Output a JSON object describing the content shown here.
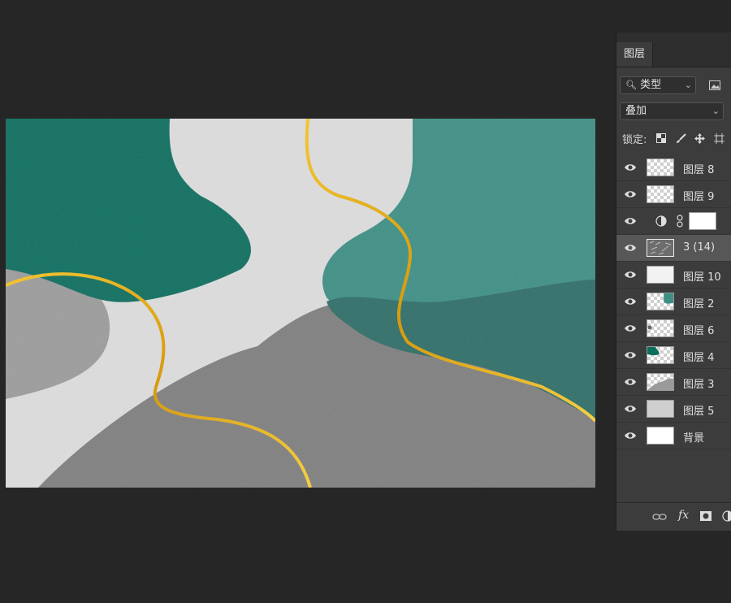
{
  "canvas": {
    "description_icon": "artwork-canvas"
  },
  "layers_panel": {
    "tab_label": "图层",
    "filter": {
      "icon": "search-icon",
      "selected": "类型"
    },
    "blend_mode": {
      "selected": "叠加"
    },
    "lock_label": "锁定:",
    "layers": [
      {
        "name": "图层 8",
        "thumb": "transparent",
        "visible": true
      },
      {
        "name": "图层 9",
        "thumb": "transparent",
        "visible": true
      },
      {
        "name": "",
        "thumb": "adjustment",
        "visible": true
      },
      {
        "name": "3 (14)",
        "thumb": "texture",
        "visible": true,
        "selected": true
      },
      {
        "name": "图层 10",
        "thumb": "light",
        "visible": true
      },
      {
        "name": "图层 2",
        "thumb": "teal-corner",
        "visible": true
      },
      {
        "name": "图层 6",
        "thumb": "dot",
        "visible": true
      },
      {
        "name": "图层 4",
        "thumb": "dark-green",
        "visible": true
      },
      {
        "name": "图层 3",
        "thumb": "gray-shape",
        "visible": true
      },
      {
        "name": "图层 5",
        "thumb": "gray-fill",
        "visible": true
      },
      {
        "name": "背景",
        "thumb": "white",
        "visible": true
      }
    ],
    "accent": {
      "teal": "#2e8b80",
      "dark_green": "#0d6b5a",
      "gold": "#e0a81a"
    }
  }
}
